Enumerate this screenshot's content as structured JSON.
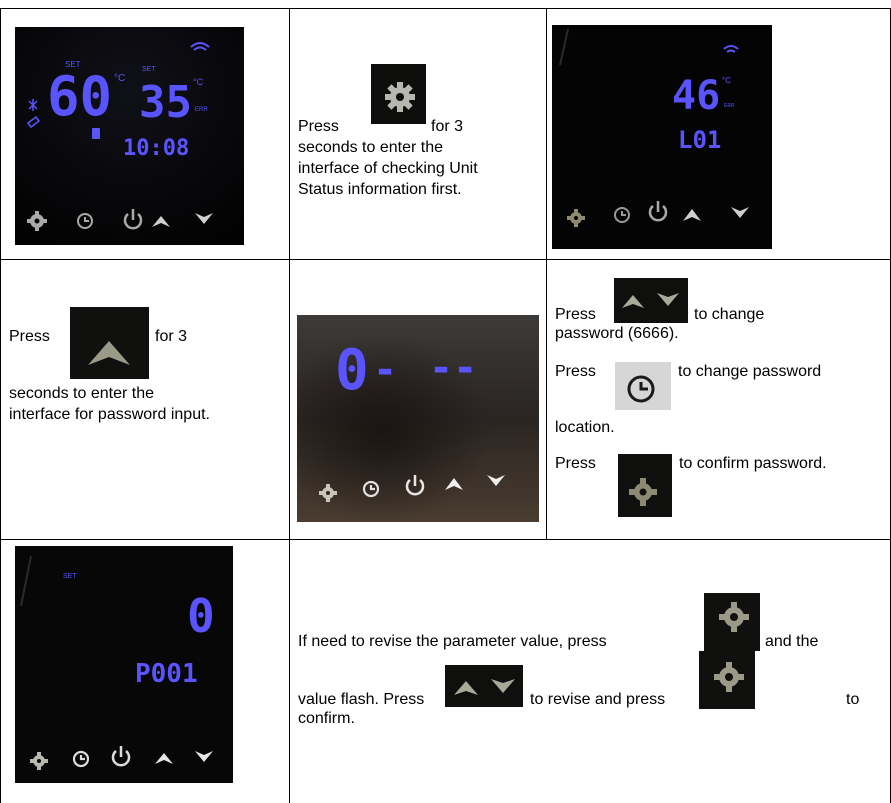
{
  "rows": [
    {
      "middle": {
        "line1_before": "Press",
        "line1_after": "for 3",
        "line2": "seconds to enter the",
        "line3": "interface of checking Unit",
        "line4": "Status information first."
      },
      "left_display": {
        "set_label_a": "SET",
        "set_temp": "60",
        "unit_a": "°C",
        "set_label_b": "SET",
        "water_temp": "35",
        "unit_b": "°C",
        "err_label": "ERR",
        "clock": "10:08"
      },
      "right_display": {
        "value": "46",
        "unit": "°C",
        "err_label": "ERR",
        "code": "L01"
      }
    },
    {
      "left": {
        "line1_before": "Press",
        "line1_after": "for 3",
        "line2": "seconds to enter the",
        "line3": "interface for password input."
      },
      "middle_display": {
        "digit": "0",
        "dash": "-",
        "dashes": "--"
      },
      "right": {
        "p1_before": "Press",
        "p1_after": "to change",
        "p1_line2": "password (6666).",
        "p2_before": "Press",
        "p2_after": "to change password",
        "p2_line2": "location.",
        "p3_before": "Press",
        "p3_after": "to confirm password."
      }
    },
    {
      "left_display": {
        "set_label": "SET",
        "value": "0",
        "code": "P001"
      },
      "right": {
        "line1_before": "If need to revise  the parameter value, press",
        "line1_after": "and the",
        "line2_before": "value flash. Press",
        "line2_mid": "to revise and press",
        "line2_after": "to",
        "line3": "confirm."
      }
    }
  ],
  "icons": [
    "gear-icon",
    "clock-icon",
    "power-icon",
    "arrow-up-icon",
    "arrow-down-icon"
  ],
  "colors": {
    "led_blue": "#5a54ff",
    "button_bg": "#0d0d0d",
    "icon_gray": "#a9a9a9"
  }
}
